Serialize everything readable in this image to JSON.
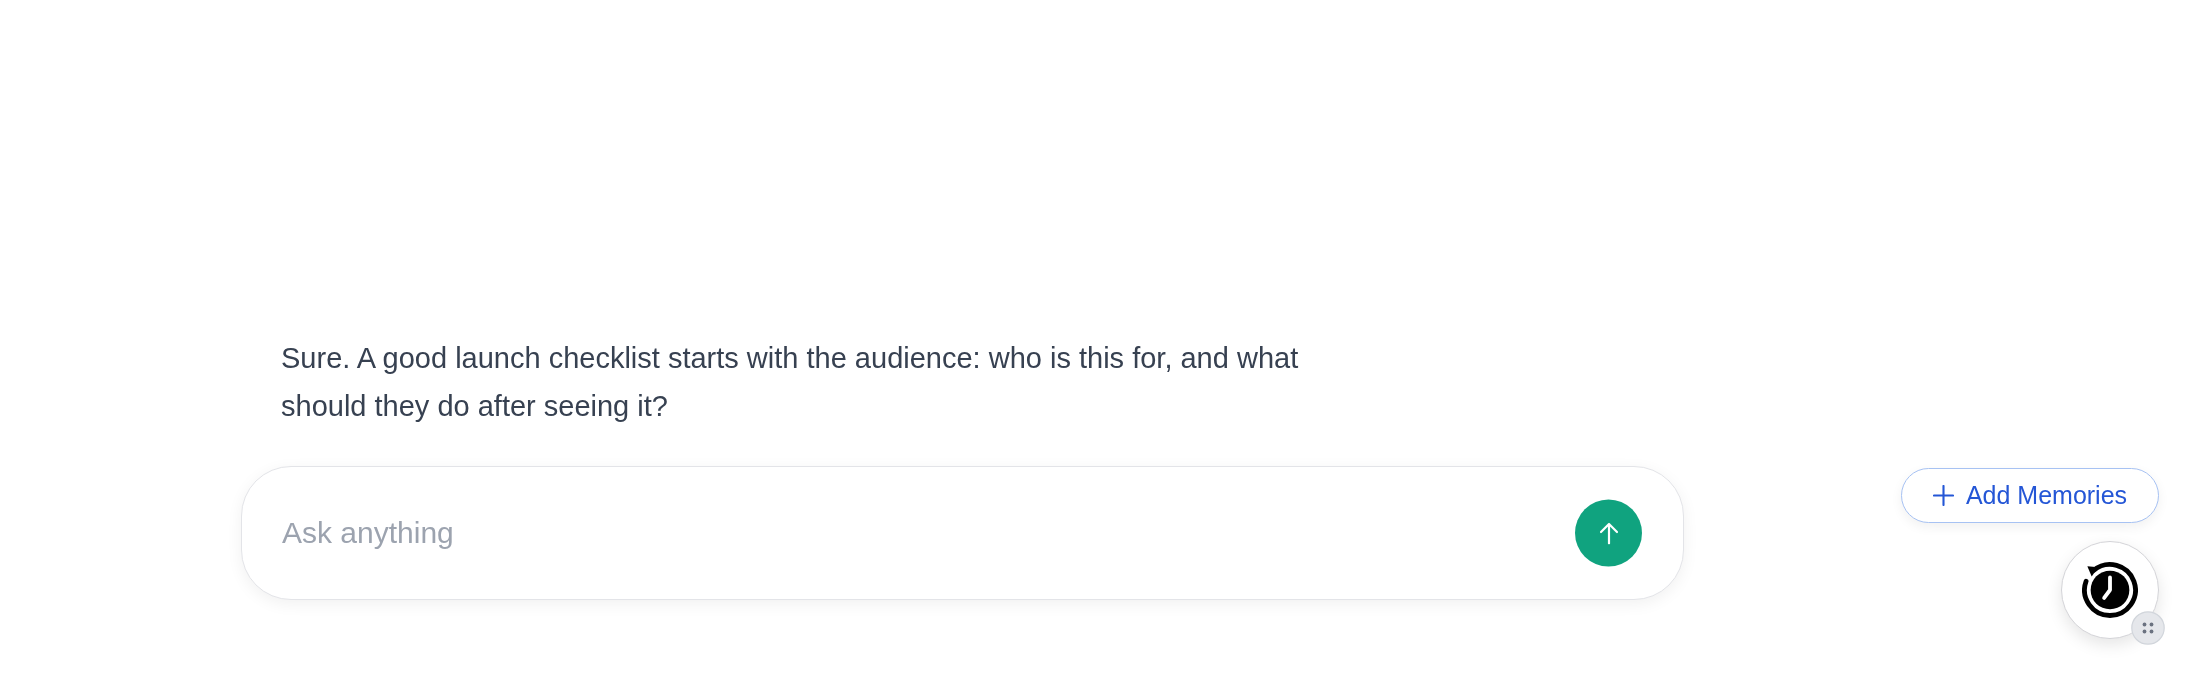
{
  "messages": [
    {
      "text": "Sure. A good launch checklist starts with the audience: who is this for, and what should they do after seeing it?"
    }
  ],
  "composer": {
    "placeholder": "Ask anything"
  },
  "memories_button": {
    "label": "Add Memories"
  }
}
